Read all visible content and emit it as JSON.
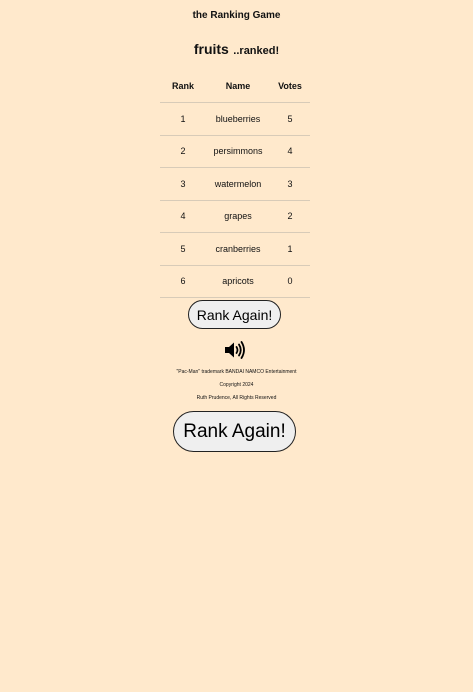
{
  "app": {
    "title": "the Ranking Game"
  },
  "heading": {
    "category": "fruits",
    "suffix": "..ranked!"
  },
  "table": {
    "headers": [
      "Rank",
      "Name",
      "Votes"
    ],
    "rows": [
      {
        "rank": "1",
        "name": "blueberries",
        "votes": "5"
      },
      {
        "rank": "2",
        "name": "persimmons",
        "votes": "4"
      },
      {
        "rank": "3",
        "name": "watermelon",
        "votes": "3"
      },
      {
        "rank": "4",
        "name": "grapes",
        "votes": "2"
      },
      {
        "rank": "5",
        "name": "cranberries",
        "votes": "1"
      },
      {
        "rank": "6",
        "name": "apricots",
        "votes": "0"
      }
    ]
  },
  "buttons": {
    "rank_again_small": "Rank Again!",
    "rank_again_large": "Rank Again!"
  },
  "sound": {
    "icon": "speaker-icon"
  },
  "footer": {
    "trademark": "\"Pac-Man\" trademark BANDAI NAMCO Entertainment",
    "copyright": "Copyright 2024",
    "rights": "Ruth Prudence, All Rights Reserved"
  },
  "colors": {
    "background": "#ffe9cc",
    "button_bg": "#efefef",
    "row_border": "#d8cbb8"
  }
}
